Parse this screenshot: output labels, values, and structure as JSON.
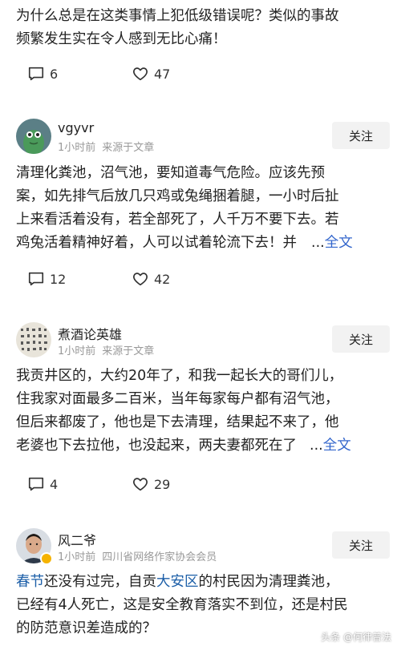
{
  "top_comment": {
    "lines": [
      "为什么总是在这类事情上犯低级错误呢？类似的事故",
      "频繁发生实在令人感到无比心痛！"
    ],
    "reply_count": "6",
    "like_count": "47"
  },
  "comments": [
    {
      "username": "vgyvr",
      "time": "1小时前",
      "source": "来源于文章",
      "follow_label": "关注",
      "lines": [
        "清理化粪池，沼气池，要知道毒气危险。应该先预",
        "案，如先排气后放几只鸡或兔绳捆着腿，一小时后扯",
        "上来看活着没有，若全部死了，人千万不要下去。若",
        "鸡兔活着精神好着，人可以试着轮流下去！并"
      ],
      "ellipsis": "...",
      "fulltext_label": "全文",
      "reply_count": "12",
      "like_count": "42"
    },
    {
      "username": "煮酒论英雄",
      "time": "1小时前",
      "source": "来源于文章",
      "follow_label": "关注",
      "lines": [
        "我贡井区的，大约20年了，和我一起长大的哥们儿，",
        "住我家对面最多二百米，当年每家每户都有沼气池，",
        "但后来都废了，他也是下去清理，结果起不来了，他",
        "老婆也下去拉他，也没起来，两夫妻都死在了"
      ],
      "ellipsis": "...",
      "fulltext_label": "全文",
      "reply_count": "4",
      "like_count": "29"
    },
    {
      "username": "风二爷",
      "time": "1小时前",
      "source": "四川省网络作家协会会员",
      "follow_label": "关注",
      "line1_link1": "春节",
      "line1_mid": "还没有过完，自贡",
      "line1_link2": "大安区",
      "line1_end": "的村民因为清理粪池，",
      "lines": [
        "已经有4人死亡，这是安全教育落实不到位，还是村民",
        "的防范意识差造成的？"
      ]
    }
  ],
  "watermark": "头条 @何律普法",
  "colors": {
    "link": "#1d5fa8",
    "fulltext": "#3366cc",
    "meta": "#999999",
    "button_bg": "#f2f2f2"
  }
}
